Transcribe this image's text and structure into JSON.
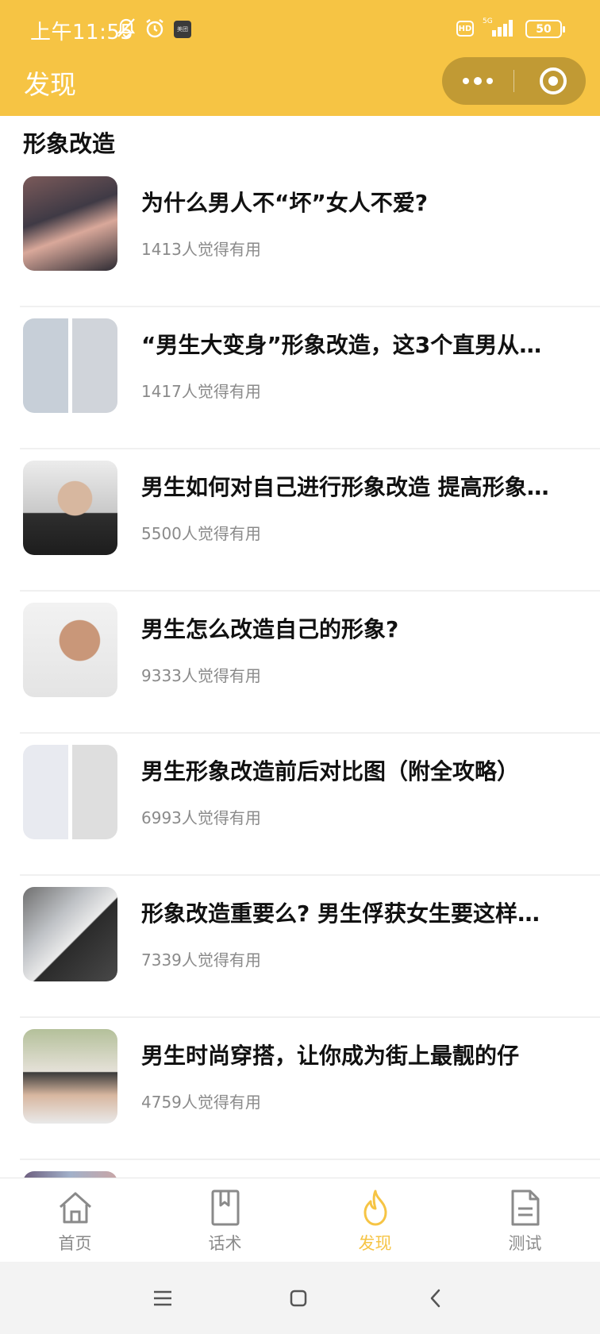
{
  "status_bar": {
    "time": "上午11:55",
    "app_badge": "美团",
    "network": "HD",
    "signal_label": "5G",
    "battery": "50"
  },
  "header": {
    "title": "发现"
  },
  "section": {
    "title": "形象改造"
  },
  "articles": [
    {
      "title": "为什么男人不“坏”女人不爱?",
      "meta": "1413人觉得有用"
    },
    {
      "title": "“男生大变身”形象改造，这3个直男从…",
      "meta": "1417人觉得有用"
    },
    {
      "title": "男生如何对自己进行形象改造 提高形象…",
      "meta": "5500人觉得有用"
    },
    {
      "title": "男生怎么改造自己的形象?",
      "meta": "9333人觉得有用"
    },
    {
      "title": "男生形象改造前后对比图（附全攻略）",
      "meta": "6993人觉得有用"
    },
    {
      "title": "形象改造重要么? 男生俘获女生要这样…",
      "meta": "7339人觉得有用"
    },
    {
      "title": "男生时尚穿搭，让你成为街上最靓的仔",
      "meta": "4759人觉得有用"
    }
  ],
  "tabbar": {
    "tabs": [
      {
        "label": "首页",
        "icon": "home-icon"
      },
      {
        "label": "话术",
        "icon": "bookmark-book-icon"
      },
      {
        "label": "发现",
        "icon": "flame-icon"
      },
      {
        "label": "测试",
        "icon": "document-icon"
      }
    ],
    "active_index": 2,
    "active_color": "#f6c444",
    "inactive_color": "#8a8a8a"
  },
  "colors": {
    "header_bg": "#f6c444",
    "sysnav_bg": "#f3f3f3"
  }
}
